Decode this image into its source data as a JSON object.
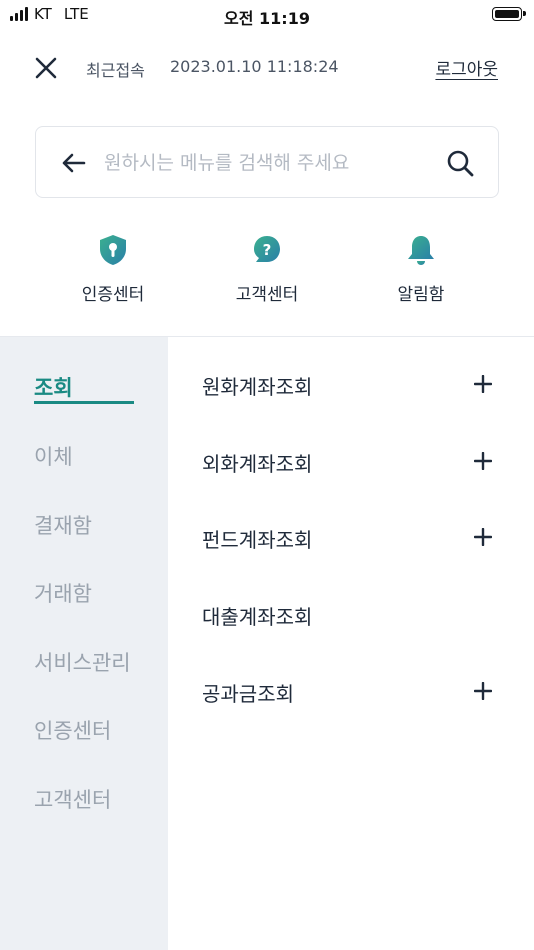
{
  "status_bar": {
    "carrier": "KT",
    "network": "LTE",
    "time": "오전 11:19"
  },
  "header": {
    "last_access_label": "최근접속",
    "last_access_time": "2023.01.10 11:18:24",
    "logout_label": "로그아웃"
  },
  "search": {
    "placeholder": "원하시는 메뉴를 검색해 주세요",
    "value": ""
  },
  "quick_links": [
    {
      "label": "인증센터",
      "icon": "shield-icon",
      "color": "#2a9d8f"
    },
    {
      "label": "고객센터",
      "icon": "chat-question-icon",
      "color": "#2a9d8f"
    },
    {
      "label": "알림함",
      "icon": "bell-icon",
      "color": "#2a9d8f"
    }
  ],
  "sidebar": {
    "items": [
      {
        "label": "조회",
        "active": true
      },
      {
        "label": "이체"
      },
      {
        "label": "결재함"
      },
      {
        "label": "거래함"
      },
      {
        "label": "서비스관리"
      },
      {
        "label": "인증센터"
      },
      {
        "label": "고객센터"
      }
    ]
  },
  "menu": {
    "items": [
      {
        "label": "원화계좌조회",
        "expandable": true
      },
      {
        "label": "외화계좌조회",
        "expandable": true
      },
      {
        "label": "펀드계좌조회",
        "expandable": true
      },
      {
        "label": "대출계좌조회",
        "expandable": false
      },
      {
        "label": "공과금조회",
        "expandable": true
      }
    ]
  },
  "colors": {
    "accent": "#1a8a83",
    "sidebar_bg": "#edf0f4",
    "inactive_text": "#9aa3ae"
  }
}
